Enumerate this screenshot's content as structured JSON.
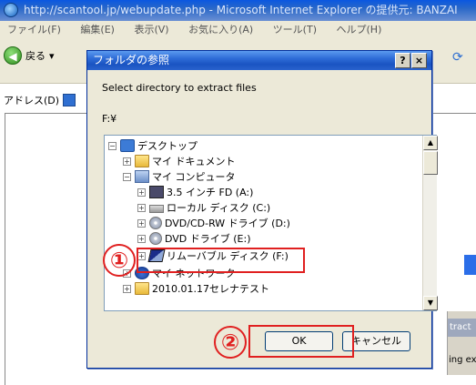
{
  "browser": {
    "title": "http://scantool.jp/webupdate.php - Microsoft Internet Explorer の提供元: BANZAI",
    "menu": [
      "ファイル(F)",
      "編集(E)",
      "表示(V)",
      "お気に入り(A)",
      "ツール(T)",
      "ヘルプ(H)"
    ],
    "back_label": "戻る",
    "address_label": "アドレス(D)",
    "bg_panel_tab": "tract",
    "bg_panel_text": "ing ex"
  },
  "dialog": {
    "title": "フォルダの参照",
    "help_button": "?",
    "close_button": "×",
    "instruction": "Select directory to extract files",
    "current_path": "F:¥",
    "tree": [
      {
        "label": "デスクトップ",
        "expander": "−",
        "icon": "desktop-icon"
      },
      {
        "label": "マイ ドキュメント",
        "expander": "+",
        "icon": "folder-icon"
      },
      {
        "label": "マイ コンピュータ",
        "expander": "−",
        "icon": "computer-icon"
      },
      {
        "label": "3.5 インチ FD (A:)",
        "expander": "+",
        "icon": "floppy-icon"
      },
      {
        "label": "ローカル ディスク (C:)",
        "expander": "+",
        "icon": "hard-disk-icon"
      },
      {
        "label": "DVD/CD-RW ドライブ (D:)",
        "expander": "+",
        "icon": "dvd-drive-icon"
      },
      {
        "label": "DVD ドライブ (E:)",
        "expander": "+",
        "icon": "dvd-drive-icon"
      },
      {
        "label": "リムーバブル ディスク (F:)",
        "expander": "+",
        "icon": "removable-disk-icon"
      },
      {
        "label": "マイ ネットワーク",
        "expander": "+",
        "icon": "network-icon"
      },
      {
        "label": "2010.01.17セレナテスト",
        "expander": "+",
        "icon": "folder-icon"
      }
    ],
    "ok_label": "OK",
    "cancel_label": "キャンセル"
  },
  "annotations": {
    "step1": "①",
    "step2": "②",
    "color": "#e02020"
  }
}
